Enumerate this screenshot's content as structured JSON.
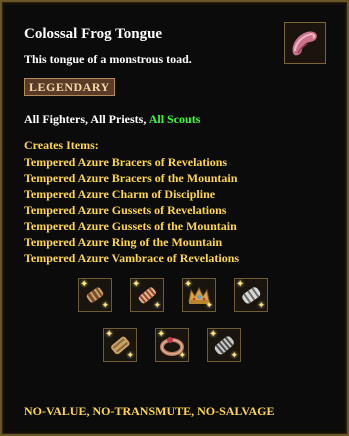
{
  "item": {
    "name": "Colossal Frog Tongue",
    "description": "This tongue of a monstrous toad.",
    "rarity": "LEGENDARY",
    "icon": "frog-tongue-icon"
  },
  "classes": {
    "fighters": "All Fighters",
    "separator1": ", ",
    "priests": "All Priests",
    "separator2": ", ",
    "scouts": "All Scouts"
  },
  "creates": {
    "heading": "Creates Items:",
    "items": [
      "Tempered Azure Bracers of Revelations",
      "Tempered Azure Bracers of the Mountain",
      "Tempered Azure Charm of Discipline",
      "Tempered Azure Gussets of Revelations",
      "Tempered Azure Gussets of the Mountain",
      "Tempered Azure Ring of the Mountain",
      "Tempered Azure Vambrace of Revelations"
    ],
    "icons": [
      "bracer-icon",
      "bracer-icon",
      "crown-charm-icon",
      "gusset-icon",
      "gusset-icon",
      "ring-icon",
      "vambrace-icon"
    ]
  },
  "footer": "NO-VALUE, NO-TRANSMUTE, NO-SALVAGE",
  "colors": {
    "title": "#ffffff",
    "created_text": "#ffd54a",
    "scouts": "#36ff36",
    "badge_bg": "#5a3b28",
    "border": "#6b5526"
  }
}
